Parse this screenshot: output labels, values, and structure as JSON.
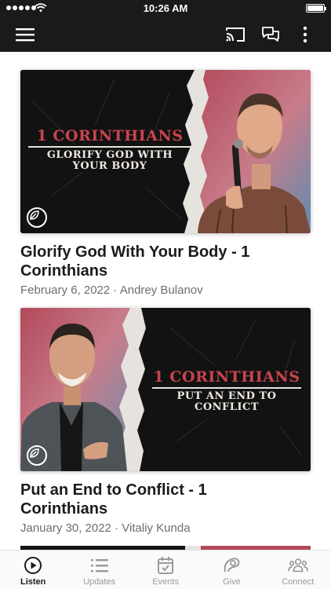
{
  "status_bar": {
    "time": "10:26 AM"
  },
  "feed": [
    {
      "series": "1 CORINTHIANS",
      "subtitle_line1": "GLORIFY GOD WITH",
      "subtitle_line2": "YOUR BODY",
      "title": "Glorify God With Your Body - 1 Corinthians",
      "meta": "February 6, 2022 · Andrey Bulanov"
    },
    {
      "series": "1 CORINTHIANS",
      "subtitle_line1": "PUT AN END TO",
      "subtitle_line2": "CONFLICT",
      "title": "Put an End to Conflict - 1 Corinthians",
      "meta": "January 30, 2022 · Vitaliy Kunda"
    }
  ],
  "tabs": [
    {
      "label": "Listen",
      "icon": "play-circle-icon",
      "active": true
    },
    {
      "label": "Updates",
      "icon": "list-icon"
    },
    {
      "label": "Events",
      "icon": "calendar-icon"
    },
    {
      "label": "Give",
      "icon": "give-icon"
    },
    {
      "label": "Connect",
      "icon": "people-icon"
    }
  ],
  "colors": {
    "bar": "#1a1a1a",
    "accent_red": "#c9444f",
    "tab_inactive": "#9a9a9a"
  }
}
